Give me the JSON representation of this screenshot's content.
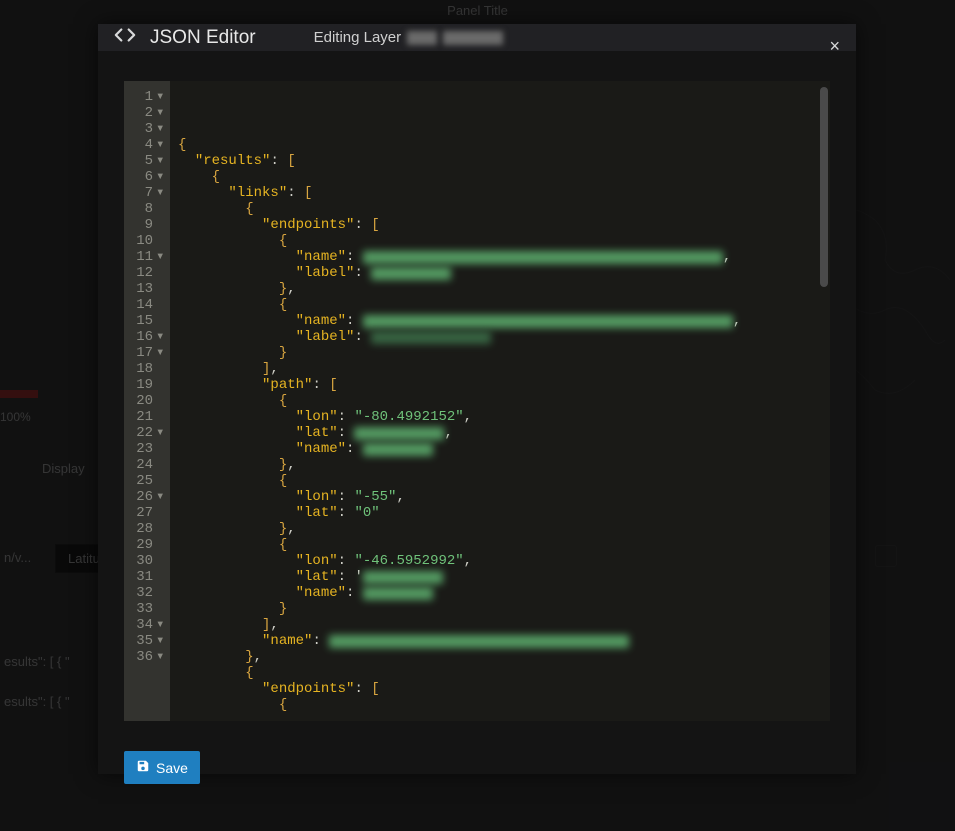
{
  "background": {
    "panel_title": "Panel Title",
    "pct_label": "100%",
    "tab_display": "Display",
    "field_latitude": "Latitude",
    "field_nv": "n/v...",
    "row_prefix": "esults\": [    {    \""
  },
  "modal": {
    "title": "JSON Editor",
    "subtitle_prefix": "Editing Layer",
    "close_label": "×",
    "save_label": "Save"
  },
  "editor": {
    "lines": [
      {
        "n": 1,
        "fold": true,
        "indent": 0,
        "tokens": [
          [
            "brace",
            "{"
          ]
        ]
      },
      {
        "n": 2,
        "fold": true,
        "indent": 1,
        "tokens": [
          [
            "key",
            "\"results\""
          ],
          [
            "colon",
            ": "
          ],
          [
            "brace",
            "["
          ]
        ]
      },
      {
        "n": 3,
        "fold": true,
        "indent": 2,
        "tokens": [
          [
            "brace",
            "{"
          ]
        ]
      },
      {
        "n": 4,
        "fold": true,
        "indent": 3,
        "tokens": [
          [
            "key",
            "\"links\""
          ],
          [
            "colon",
            ": "
          ],
          [
            "brace",
            "["
          ]
        ]
      },
      {
        "n": 5,
        "fold": true,
        "indent": 4,
        "tokens": [
          [
            "brace",
            "{"
          ]
        ]
      },
      {
        "n": 6,
        "fold": true,
        "indent": 5,
        "tokens": [
          [
            "key",
            "\"endpoints\""
          ],
          [
            "colon",
            ": "
          ],
          [
            "brace",
            "["
          ]
        ]
      },
      {
        "n": 7,
        "fold": true,
        "indent": 6,
        "tokens": [
          [
            "brace",
            "{"
          ]
        ]
      },
      {
        "n": 8,
        "fold": false,
        "indent": 7,
        "tokens": [
          [
            "key",
            "\"name\""
          ],
          [
            "colon",
            ": "
          ],
          [
            "blur_g",
            360
          ],
          [
            "punc",
            ","
          ]
        ]
      },
      {
        "n": 9,
        "fold": false,
        "indent": 7,
        "tokens": [
          [
            "key",
            "\"label\""
          ],
          [
            "colon",
            ": "
          ],
          [
            "blur_g",
            80
          ]
        ]
      },
      {
        "n": 10,
        "fold": false,
        "indent": 6,
        "tokens": [
          [
            "brace",
            "}"
          ],
          [
            "punc",
            ","
          ]
        ]
      },
      {
        "n": 11,
        "fold": true,
        "indent": 6,
        "tokens": [
          [
            "brace",
            "{"
          ]
        ]
      },
      {
        "n": 12,
        "fold": false,
        "indent": 7,
        "tokens": [
          [
            "key",
            "\"name\""
          ],
          [
            "colon",
            ": "
          ],
          [
            "blur_g",
            370
          ],
          [
            "punc",
            ","
          ]
        ]
      },
      {
        "n": 13,
        "fold": false,
        "indent": 7,
        "tokens": [
          [
            "key",
            "\"label\""
          ],
          [
            "colon",
            ": "
          ],
          [
            "blur_d",
            120
          ]
        ]
      },
      {
        "n": 14,
        "fold": false,
        "indent": 6,
        "tokens": [
          [
            "brace",
            "}"
          ]
        ]
      },
      {
        "n": 15,
        "fold": false,
        "indent": 5,
        "tokens": [
          [
            "brace",
            "]"
          ],
          [
            "punc",
            ","
          ]
        ]
      },
      {
        "n": 16,
        "fold": true,
        "indent": 5,
        "tokens": [
          [
            "key",
            "\"path\""
          ],
          [
            "colon",
            ": "
          ],
          [
            "brace",
            "["
          ]
        ]
      },
      {
        "n": 17,
        "fold": true,
        "indent": 6,
        "tokens": [
          [
            "brace",
            "{"
          ]
        ]
      },
      {
        "n": 18,
        "fold": false,
        "indent": 7,
        "tokens": [
          [
            "key",
            "\"lon\""
          ],
          [
            "colon",
            ": "
          ],
          [
            "str",
            "\"-80.4992152\""
          ],
          [
            "punc",
            ","
          ]
        ]
      },
      {
        "n": 19,
        "fold": false,
        "indent": 7,
        "tokens": [
          [
            "key",
            "\"lat\""
          ],
          [
            "colon",
            ": "
          ],
          [
            "blur_g",
            90
          ],
          [
            "punc",
            ","
          ]
        ]
      },
      {
        "n": 20,
        "fold": false,
        "indent": 7,
        "tokens": [
          [
            "key",
            "\"name\""
          ],
          [
            "colon",
            ": "
          ],
          [
            "blur_g",
            70
          ]
        ]
      },
      {
        "n": 21,
        "fold": false,
        "indent": 6,
        "tokens": [
          [
            "brace",
            "}"
          ],
          [
            "punc",
            ","
          ]
        ]
      },
      {
        "n": 22,
        "fold": true,
        "indent": 6,
        "tokens": [
          [
            "brace",
            "{"
          ]
        ]
      },
      {
        "n": 23,
        "fold": false,
        "indent": 7,
        "tokens": [
          [
            "key",
            "\"lon\""
          ],
          [
            "colon",
            ": "
          ],
          [
            "str",
            "\"-55\""
          ],
          [
            "punc",
            ","
          ]
        ]
      },
      {
        "n": 24,
        "fold": false,
        "indent": 7,
        "tokens": [
          [
            "key",
            "\"lat\""
          ],
          [
            "colon",
            ": "
          ],
          [
            "str",
            "\"0\""
          ]
        ]
      },
      {
        "n": 25,
        "fold": false,
        "indent": 6,
        "tokens": [
          [
            "brace",
            "}"
          ],
          [
            "punc",
            ","
          ]
        ]
      },
      {
        "n": 26,
        "fold": true,
        "indent": 6,
        "tokens": [
          [
            "brace",
            "{"
          ]
        ]
      },
      {
        "n": 27,
        "fold": false,
        "indent": 7,
        "tokens": [
          [
            "key",
            "\"lon\""
          ],
          [
            "colon",
            ": "
          ],
          [
            "str",
            "\"-46.5952992\""
          ],
          [
            "punc",
            ","
          ]
        ]
      },
      {
        "n": 28,
        "fold": false,
        "indent": 7,
        "tokens": [
          [
            "key",
            "\"lat\""
          ],
          [
            "colon",
            ": "
          ],
          [
            "punc",
            "'"
          ],
          [
            "blur_g",
            80
          ]
        ]
      },
      {
        "n": 29,
        "fold": false,
        "indent": 7,
        "tokens": [
          [
            "key",
            "\"name\""
          ],
          [
            "colon",
            ": "
          ],
          [
            "blur_g",
            70
          ]
        ]
      },
      {
        "n": 30,
        "fold": false,
        "indent": 6,
        "tokens": [
          [
            "brace",
            "}"
          ]
        ]
      },
      {
        "n": 31,
        "fold": false,
        "indent": 5,
        "tokens": [
          [
            "brace",
            "]"
          ],
          [
            "punc",
            ","
          ]
        ]
      },
      {
        "n": 32,
        "fold": false,
        "indent": 5,
        "tokens": [
          [
            "key",
            "\"name\""
          ],
          [
            "colon",
            ": "
          ],
          [
            "blur_g",
            300
          ]
        ]
      },
      {
        "n": 33,
        "fold": false,
        "indent": 4,
        "tokens": [
          [
            "brace",
            "}"
          ],
          [
            "punc",
            ","
          ]
        ]
      },
      {
        "n": 34,
        "fold": true,
        "indent": 4,
        "tokens": [
          [
            "brace",
            "{"
          ]
        ]
      },
      {
        "n": 35,
        "fold": true,
        "indent": 5,
        "tokens": [
          [
            "key",
            "\"endpoints\""
          ],
          [
            "colon",
            ": "
          ],
          [
            "brace",
            "["
          ]
        ]
      },
      {
        "n": 36,
        "fold": true,
        "indent": 6,
        "tokens": [
          [
            "brace",
            "{"
          ]
        ]
      }
    ]
  }
}
